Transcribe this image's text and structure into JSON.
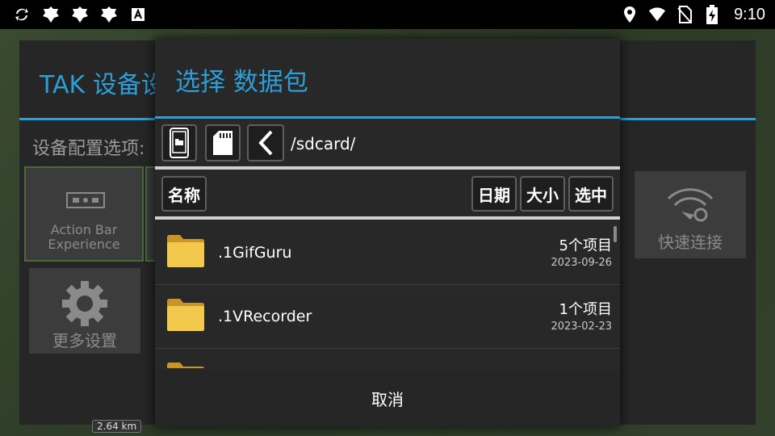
{
  "status_bar": {
    "time": "9:10",
    "left_icons": [
      "sync-icon",
      "notification-icon",
      "notification-icon",
      "notification-icon",
      "font-icon"
    ],
    "right_icons": [
      "location-icon",
      "wifi-icon",
      "no-sim-icon",
      "battery-charging-icon"
    ]
  },
  "background_dialog": {
    "title": "TAK 设备设",
    "section_label": "设备配置选项:",
    "tiles": {
      "action_bar": "Action Bar\nExperience",
      "more_settings": "更多设置",
      "quick_connect": "快速连接"
    },
    "scale": "2.64 km"
  },
  "dialog": {
    "title": "选择 数据包",
    "path": "/sdcard/",
    "sort": {
      "name": "名称",
      "date": "日期",
      "size": "大小",
      "select": "选中"
    },
    "files": [
      {
        "name": ".1GifGuru",
        "count": "5个项目",
        "date": "2023-09-26"
      },
      {
        "name": ".1VRecorder",
        "count": "1个项目",
        "date": "2023-02-23"
      }
    ],
    "cancel": "取消"
  },
  "colors": {
    "accent": "#2d9fd8",
    "folder": "#e8b83a",
    "dialog_bg": "#282828"
  }
}
